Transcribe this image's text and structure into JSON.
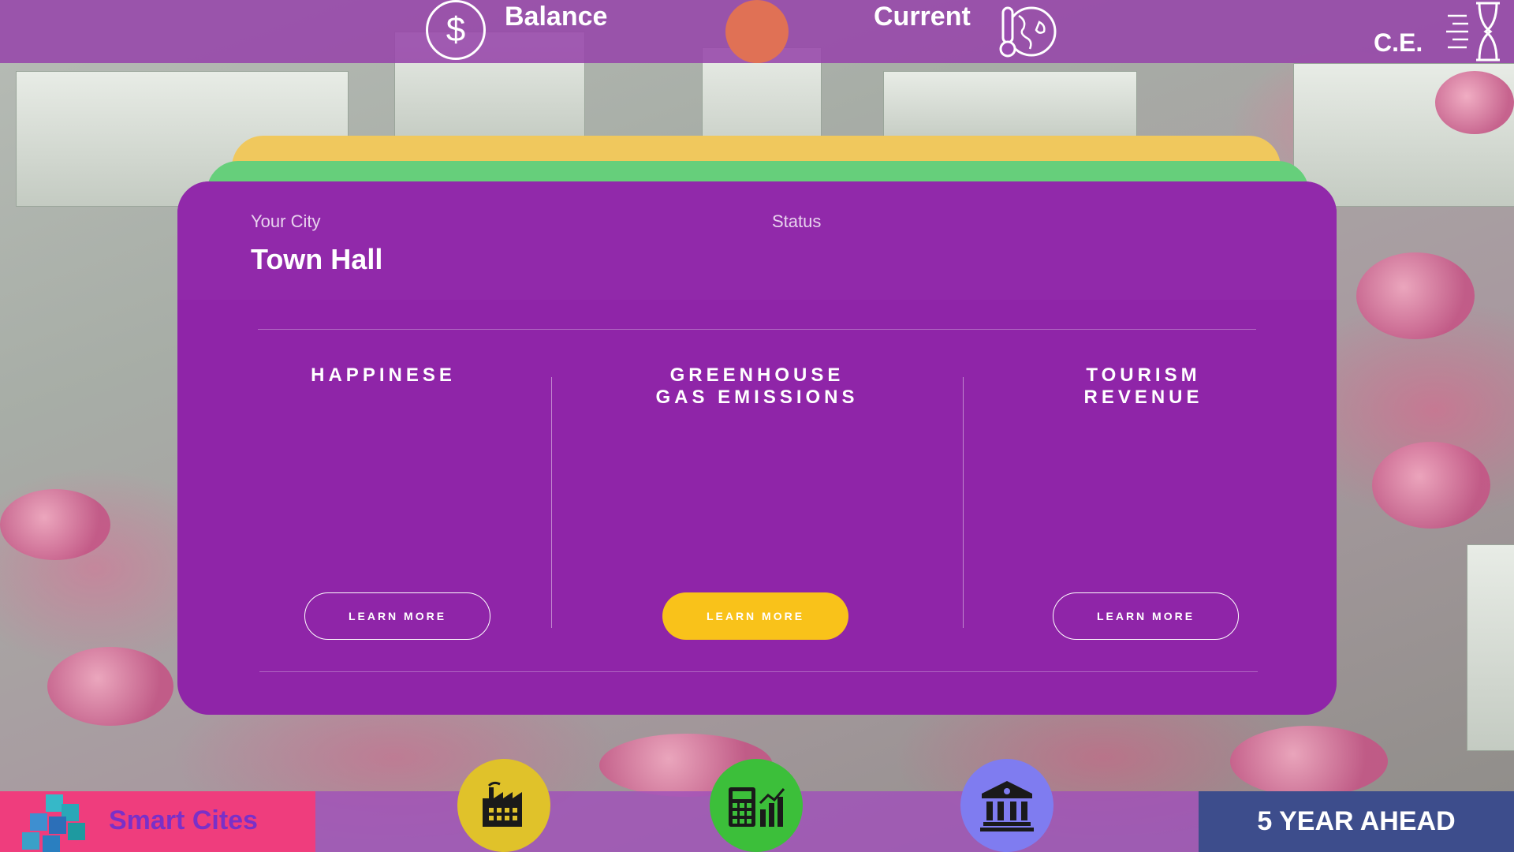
{
  "topbar": {
    "balance_label": "Balance",
    "current_label": "Current",
    "ce_label": "C.E.",
    "icons": [
      "dollar-icon",
      "climate-globe-icon",
      "hourglass-icon"
    ],
    "status_dot_color": "#e07155"
  },
  "card": {
    "your_city_label": "Your City",
    "city_name": "Town Hall",
    "status_label": "Status",
    "columns": [
      {
        "title": "HAPPINESE",
        "button_label": "LEARN MORE",
        "button_style": "outline"
      },
      {
        "title": "GREENHOUSE\nGAS EMISSIONS",
        "button_label": "LEARN MORE",
        "button_style": "filled"
      },
      {
        "title": "TOURISM\nREVENUE",
        "button_label": "LEARN MORE",
        "button_style": "outline"
      }
    ],
    "colors": {
      "card": "#8f25a8",
      "stack_green": "#66cf7b",
      "stack_yellow": "#f0c85d",
      "accent_button": "#f9c21a"
    }
  },
  "bottombar": {
    "brand_name": "Smart Cites",
    "year_ahead_label": "5 YEAR AHEAD",
    "buttons": [
      {
        "icon": "factory-icon",
        "color": "#e0c22a"
      },
      {
        "icon": "calculator-chart-icon",
        "color": "#3cbf3a"
      },
      {
        "icon": "bank-building-icon",
        "color": "#7f7cf0"
      }
    ]
  }
}
